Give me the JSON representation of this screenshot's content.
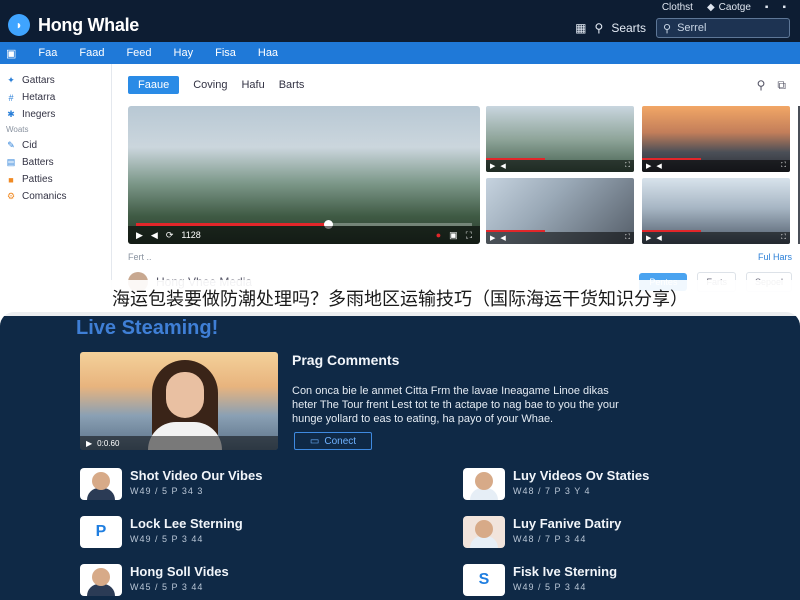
{
  "colors": {
    "topbar": "#0d1d33",
    "accent": "#1f79d8",
    "panel": "#0f2946",
    "live_title": "#3f7fd6"
  },
  "topbar": {
    "logo_icon": "whale-logo-icon",
    "title": "Hong Whale",
    "links": [
      {
        "label": "Clothst",
        "icon": ""
      },
      {
        "label": "Caotge",
        "icon": "diamond-icon"
      },
      {
        "label": "",
        "icon": ""
      },
      {
        "label": "",
        "icon": ""
      }
    ],
    "searchs_label": "Searts",
    "search_placeholder": "Serrel"
  },
  "nav": {
    "items": [
      "Faa",
      "Faad",
      "Feed",
      "Hay",
      "Fisa",
      "Haa"
    ]
  },
  "sidebar": {
    "items": [
      {
        "label": "Gattars",
        "icon": "tag-icon"
      },
      {
        "label": "Hetarra",
        "icon": "hash-icon"
      },
      {
        "label": "Inegers",
        "icon": "sparkle-icon"
      }
    ],
    "section": "Woats",
    "items2": [
      {
        "label": "Cid",
        "icon": "pin-icon"
      },
      {
        "label": "Batters",
        "icon": "chart-icon"
      },
      {
        "label": "Patties",
        "icon": "flag-icon"
      },
      {
        "label": "Comanics",
        "icon": "gear-icon"
      }
    ]
  },
  "main": {
    "tabs": [
      "Faaue",
      "Coving",
      "Hafu",
      "Barts"
    ],
    "player": {
      "time": "1128",
      "progress": 0.57
    },
    "under_left": "Fert ..",
    "under_right": "Ful Hars",
    "channel": {
      "name": "Hong Vhee Media",
      "subscribe": "Pentes",
      "share": "Farts",
      "more": "Sepoel"
    }
  },
  "caption": "海运包装要做防潮处理吗？多雨地区运输技巧（国际海运干货知识分享）",
  "live": {
    "title": "Live Steaming!",
    "feature": {
      "title": "Prag Comments",
      "desc": [
        "Con onca bie le anmet Citta Frm the lavae Ineagame Linoe dikas",
        "heter The Tour frent Lest tot te th actape to nag bae to you the your",
        "hunge yollard to eas to eating, ha payo of your Whae."
      ],
      "time": "0:0.60",
      "button": "Conect"
    },
    "items": [
      {
        "title": "Shot Video Our Vibes",
        "meta": "W49 / 5 P 34 3",
        "thumb": "face-a"
      },
      {
        "title": "Luy Videos Ov Staties",
        "meta": "W48 / 7 P 3 Y 4",
        "thumb": "face-b"
      },
      {
        "title": "Lock Lee Sterning",
        "meta": "W49 / 5 P 3 44",
        "thumb": "P"
      },
      {
        "title": "Luy Fanive Datiry",
        "meta": "W48 / 7 P 3 44",
        "thumb": "face-d"
      },
      {
        "title": "Hong Soll Vides",
        "meta": "W45 / 5 P 3 44",
        "thumb": "face-c"
      },
      {
        "title": "Fisk Ive Sterning",
        "meta": "W49 / 5 P 3 44",
        "thumb": "S"
      }
    ]
  }
}
